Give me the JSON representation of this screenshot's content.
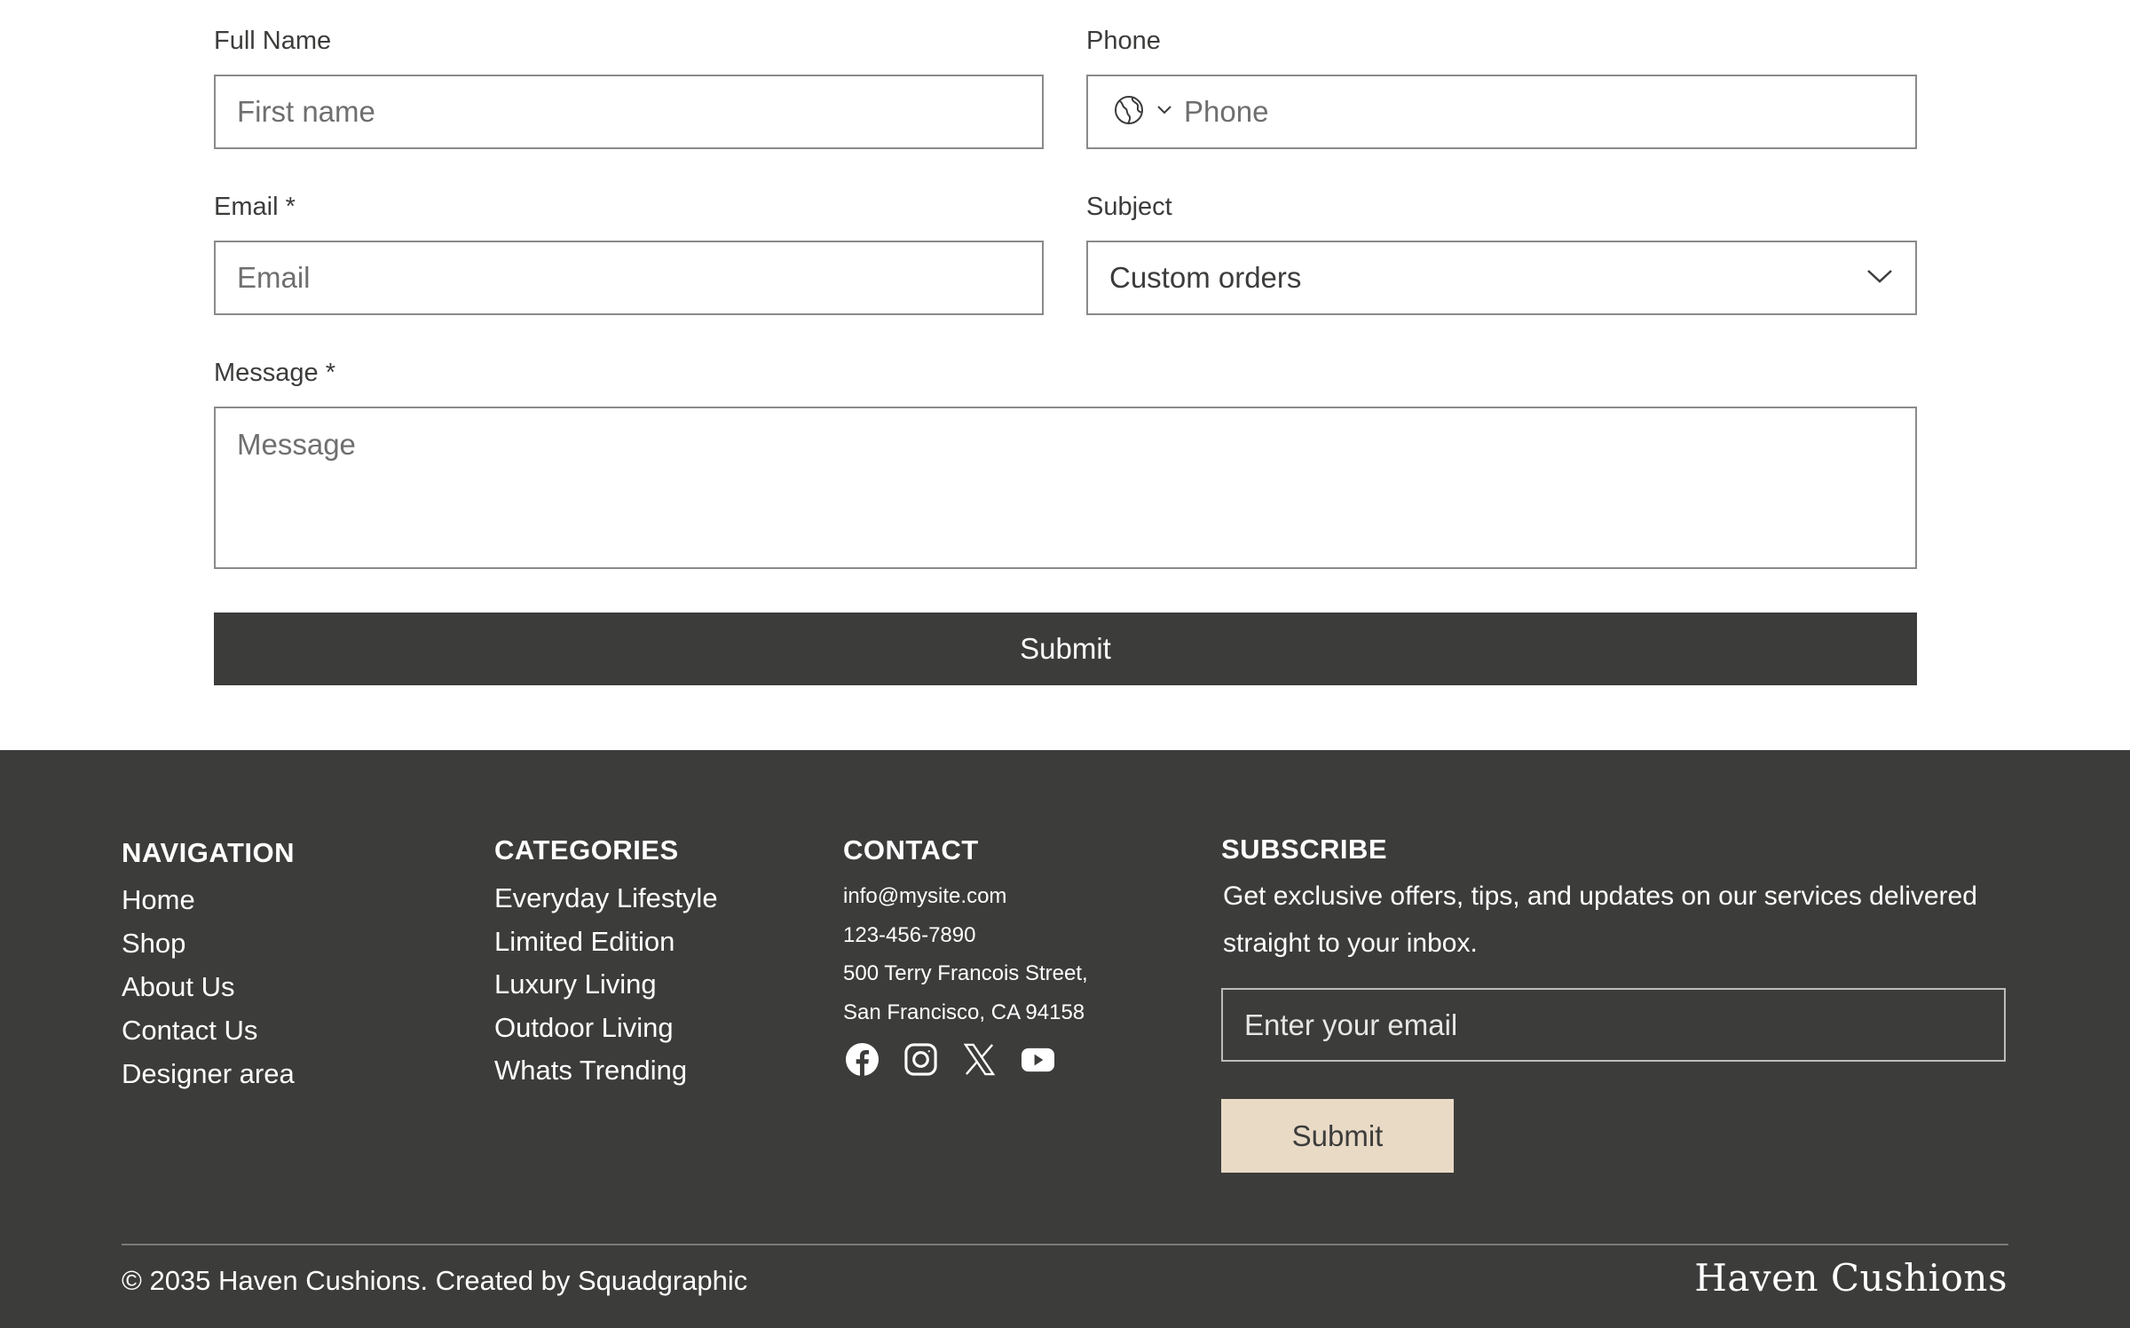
{
  "form": {
    "full_name": {
      "label": "Full Name",
      "placeholder": "First name"
    },
    "phone": {
      "label": "Phone",
      "placeholder": "Phone",
      "country_icon": "globe-icon"
    },
    "email": {
      "label": "Email *",
      "placeholder": "Email"
    },
    "subject": {
      "label": "Subject",
      "value": "Custom orders"
    },
    "message": {
      "label": "Message *",
      "placeholder": "Message"
    },
    "submit_label": "Submit"
  },
  "footer": {
    "navigation": {
      "title": "NAVIGATION",
      "items": [
        "Home",
        "Shop",
        "About Us",
        "Contact Us",
        "Designer area"
      ]
    },
    "categories": {
      "title": "CATEGORIES",
      "items": [
        "Everyday Lifestyle",
        "Limited Edition",
        "Luxury Living",
        "Outdoor Living",
        "Whats Trending"
      ]
    },
    "contact": {
      "title": "CONTACT",
      "email": "info@mysite.com",
      "phone": "123-456-7890",
      "address_line1": "500 Terry Francois Street,",
      "address_line2": "San Francisco, CA 94158",
      "socials": [
        "facebook-icon",
        "instagram-icon",
        "x-icon",
        "youtube-icon"
      ]
    },
    "subscribe": {
      "title": "SUBSCRIBE",
      "text": "Get exclusive offers, tips, and updates on our services delivered straight to your inbox.",
      "placeholder": "Enter your email",
      "button_label": "Submit"
    },
    "copyright": "© 2035 Haven Cushions. Created by Squadgraphic",
    "brand": "Haven Cushions"
  },
  "colors": {
    "dark": "#3c3c3b",
    "accent_button": "#e9dac6",
    "input_border": "#8a8a8a"
  }
}
